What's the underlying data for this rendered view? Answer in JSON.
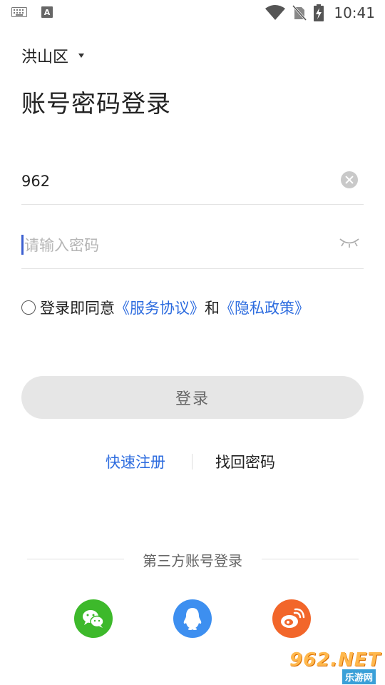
{
  "status_bar": {
    "time": "10:41",
    "left_icons": [
      "keyboard-icon",
      "a-icon"
    ],
    "right_icons": [
      "wifi-icon",
      "no-sim-icon",
      "battery-charging-icon"
    ]
  },
  "region": {
    "label": "洪山区",
    "icon": "caret-down-icon"
  },
  "title": "账号密码登录",
  "account": {
    "value": "962",
    "clear_icon": "clear-icon"
  },
  "password": {
    "placeholder": "请输入密码",
    "value": "",
    "toggle_icon": "eye-closed-icon"
  },
  "agreement": {
    "prefix": "登录即同意",
    "terms": "《服务协议》",
    "and": "和",
    "privacy": "《隐私政策》",
    "checked": false
  },
  "login_button": {
    "label": "登录"
  },
  "links": {
    "register": "快速注册",
    "forgot": "找回密码"
  },
  "third_party": {
    "label": "第三方账号登录",
    "providers": [
      {
        "name": "wechat",
        "icon": "wechat-icon",
        "color": "#3db92b"
      },
      {
        "name": "qq",
        "icon": "qq-icon",
        "color": "#3d8ff0"
      },
      {
        "name": "weibo",
        "icon": "weibo-icon",
        "color": "#f2662a"
      }
    ]
  },
  "watermark": {
    "top": "962.NET",
    "bottom": "乐游网"
  },
  "colors": {
    "link": "#2d6cdf",
    "button_bg": "#e6e6e6",
    "cursor": "#3b5fd0"
  }
}
